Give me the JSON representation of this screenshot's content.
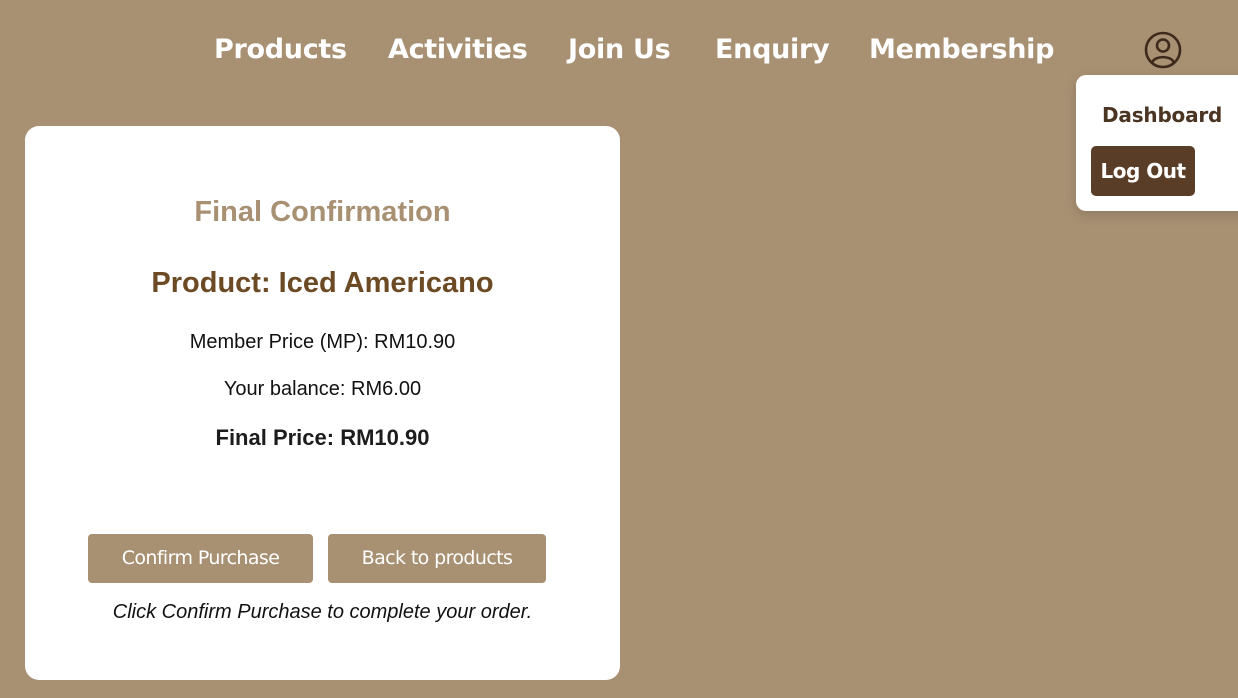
{
  "nav": {
    "items": [
      {
        "label": "Products"
      },
      {
        "label": "Activities"
      },
      {
        "label": "Join Us"
      },
      {
        "label": "Enquiry"
      },
      {
        "label": "Membership"
      }
    ],
    "user_icon": "user-circle-icon"
  },
  "user_menu": {
    "dashboard_label": "Dashboard",
    "logout_label": "Log Out"
  },
  "confirmation": {
    "title": "Final Confirmation",
    "product_line": "Product: Iced Americano",
    "member_price_line": "Member Price (MP): RM10.90",
    "balance_line": "Your balance: RM6.00",
    "final_price_line": "Final Price: RM10.90",
    "confirm_label": "Confirm Purchase",
    "back_label": "Back to products",
    "hint": "Click Confirm Purchase to complete your order."
  },
  "colors": {
    "background": "#a89073",
    "title": "#a89073",
    "product": "#6b4a24",
    "button": "#a89073",
    "logout_button": "#5a3d26"
  }
}
